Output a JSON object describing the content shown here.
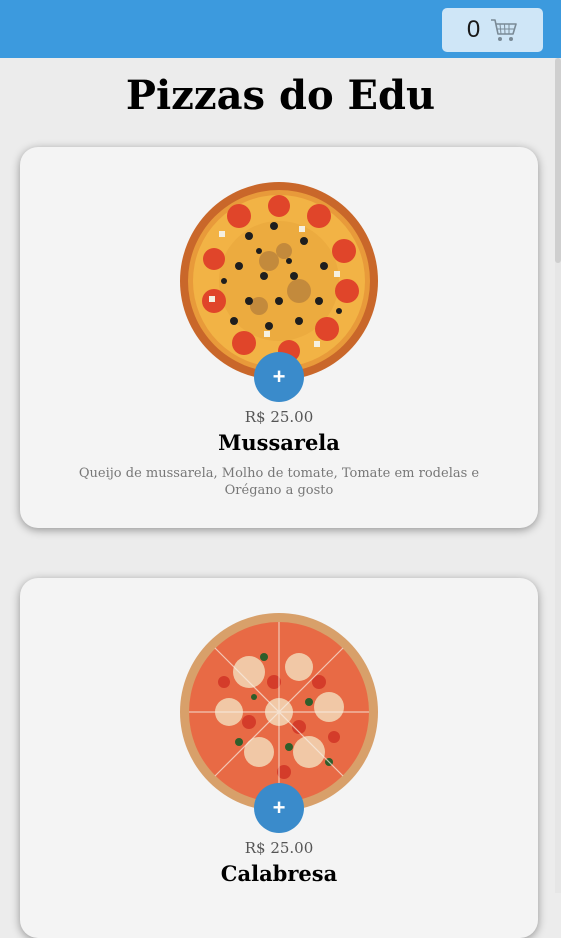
{
  "header": {
    "cart_count": "0",
    "cart_icon": "shopping-cart-icon"
  },
  "page": {
    "title": "Pizzas do Edu"
  },
  "pizzas": [
    {
      "price": "R$ 25.00",
      "name": "Mussarela",
      "description": "Queijo de mussarela, Molho de tomate, Tomate em rodelas e Orégano a gosto",
      "add_label": "+"
    },
    {
      "price": "R$ 25.00",
      "name": "Calabresa",
      "add_label": "+"
    }
  ],
  "colors": {
    "topbar": "#3c9ade",
    "add_button": "#3a8bcb",
    "card_background": "#f4f4f4",
    "page_background": "#ececec"
  }
}
